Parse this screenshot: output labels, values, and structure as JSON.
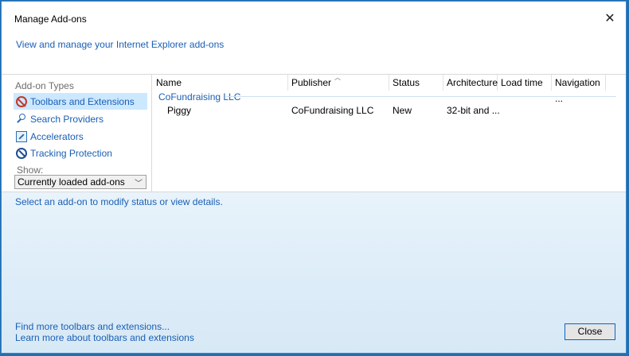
{
  "window": {
    "title": "Manage Add-ons"
  },
  "header": {
    "link_text": "View and manage your Internet Explorer add-ons"
  },
  "sidebar": {
    "heading": "Add-on Types",
    "items": [
      {
        "label": "Toolbars and Extensions",
        "icon": "toolbar-extension-icon",
        "selected": true
      },
      {
        "label": "Search Providers",
        "icon": "search-icon",
        "selected": false
      },
      {
        "label": "Accelerators",
        "icon": "accelerator-icon",
        "selected": false
      },
      {
        "label": "Tracking Protection",
        "icon": "tracking-protection-icon",
        "selected": false
      }
    ],
    "show_label": "Show:",
    "show_value": "Currently loaded add-ons"
  },
  "grid": {
    "columns": [
      "Name",
      "Publisher",
      "Status",
      "Architecture",
      "Load time",
      "Navigation ..."
    ],
    "group": "CoFundraising LLC",
    "rows": [
      {
        "name": "Piggy",
        "publisher": "CoFundraising LLC",
        "status": "New",
        "architecture": "32-bit and ..."
      }
    ]
  },
  "details": {
    "message": "Select an add-on to modify status or view details.",
    "find_more": "Find more toolbars and extensions...",
    "learn_more": "Learn more about toolbars and extensions",
    "close_label": "Close"
  },
  "colors": {
    "accent": "#1a5fb4",
    "selection": "#cce8ff",
    "frame": "#1f6fb2"
  }
}
